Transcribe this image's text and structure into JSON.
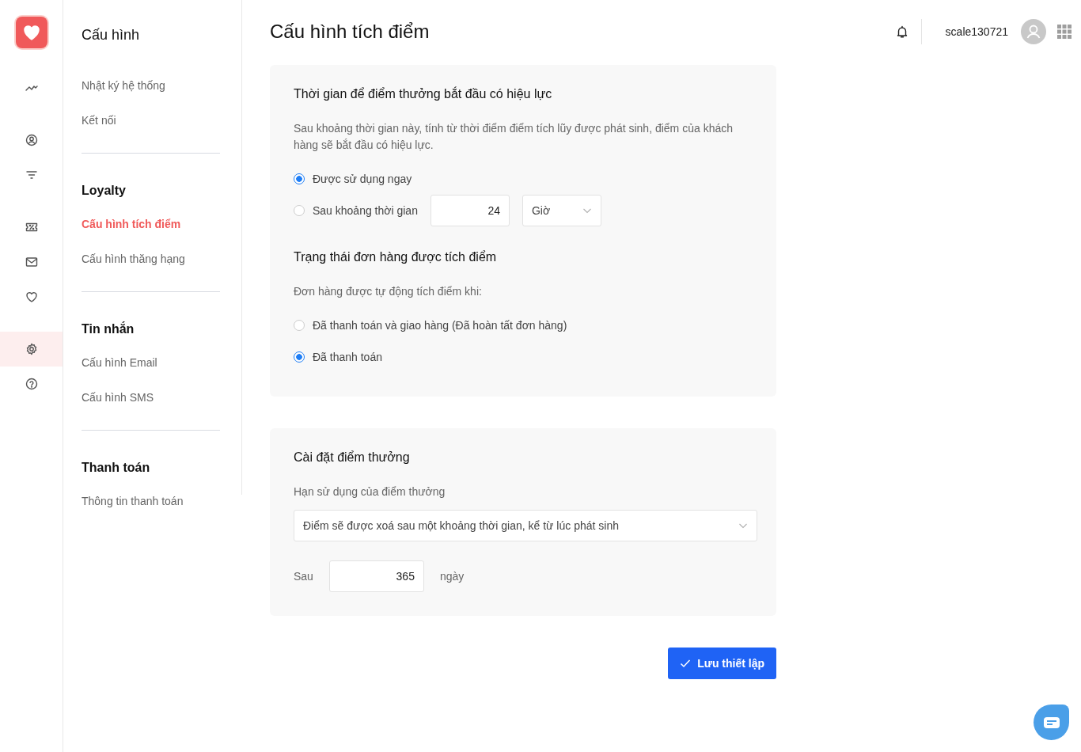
{
  "rail": {
    "groups": [
      [
        {
          "kind": "chart",
          "selected": false
        }
      ],
      [
        {
          "kind": "user",
          "selected": false
        },
        {
          "kind": "filter",
          "selected": false
        }
      ],
      [
        {
          "kind": "coupon",
          "selected": false
        },
        {
          "kind": "mail",
          "selected": false
        },
        {
          "kind": "heart",
          "selected": false
        }
      ],
      [
        {
          "kind": "settings",
          "selected": true
        },
        {
          "kind": "help",
          "selected": false
        }
      ]
    ]
  },
  "subnav": {
    "title": "Cấu hình",
    "sections": [
      {
        "items": [
          {
            "label": "Nhật ký hệ thống",
            "selected": false
          },
          {
            "label": "Kết nối",
            "selected": false
          }
        ]
      },
      {
        "heading": "Loyalty",
        "items": [
          {
            "label": "Cấu hình tích điểm",
            "selected": true
          },
          {
            "label": "Cấu hình thăng hạng",
            "selected": false
          }
        ]
      },
      {
        "heading": "Tin nhắn",
        "items": [
          {
            "label": "Cấu hình Email",
            "selected": false
          },
          {
            "label": "Cấu hình SMS",
            "selected": false
          }
        ]
      },
      {
        "heading": "Thanh toán",
        "items": [
          {
            "label": "Thông tin thanh toán",
            "selected": false
          }
        ]
      }
    ]
  },
  "header": {
    "title": "Cấu hình tích điểm",
    "username": "scale130721"
  },
  "cards": [
    {
      "blocks": [
        {
          "kind": "heading",
          "text": "Thời gian để điểm thưởng bắt đầu có hiệu lực"
        },
        {
          "kind": "text",
          "text": "Sau khoảng thời gian này, tính từ thời điểm điểm tích lũy được phát sinh, điểm của khách hàng sẽ bắt đầu có hiệu lực."
        },
        {
          "kind": "radio",
          "label": "Được sử dụng ngay",
          "selected": true
        },
        {
          "kind": "radio",
          "label": "Sau khoảng thời gian",
          "selected": false,
          "value": "24",
          "unit": "Giờ"
        },
        {
          "kind": "heading",
          "text": "Trạng thái đơn hàng được tích điểm"
        },
        {
          "kind": "text",
          "text": "Đơn hàng được tự động tích điểm khi:"
        },
        {
          "kind": "radio",
          "label": "Đã thanh toán và giao hàng (Đã hoàn tất đơn hàng)",
          "selected": false
        },
        {
          "kind": "radio",
          "label": "Đã thanh toán",
          "selected": true
        }
      ]
    },
    {
      "blocks": [
        {
          "kind": "heading",
          "text": "Cài đặt điểm thưởng"
        },
        {
          "kind": "text",
          "text": "Hạn sử dụng của điểm thưởng"
        },
        {
          "kind": "select",
          "value": "Điểm sẽ được xoá sau một khoảng thời gian, kể từ lúc phát sinh"
        },
        {
          "kind": "amount",
          "prefix": "Sau",
          "value": "365",
          "suffix": "ngày"
        }
      ]
    }
  ],
  "save_button": "Lưu thiết lập"
}
